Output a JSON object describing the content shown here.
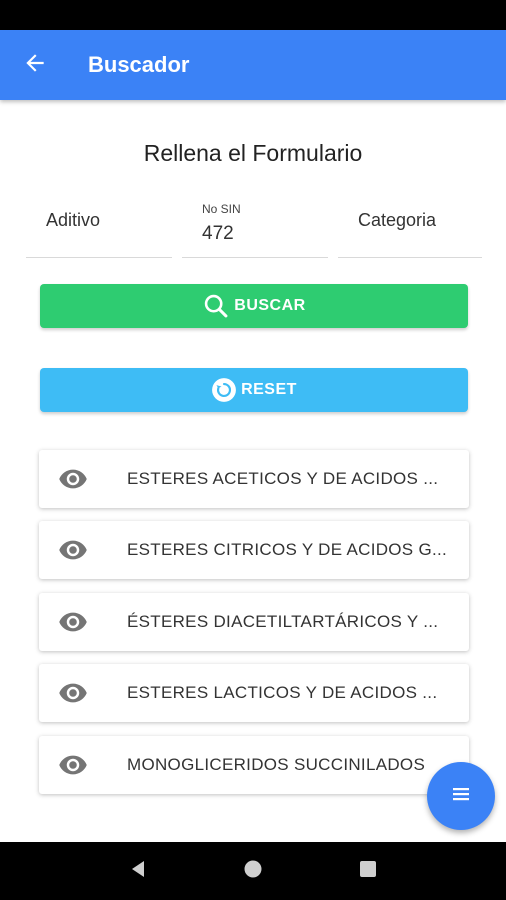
{
  "app_bar": {
    "title": "Buscador",
    "back_icon": "arrow-back-icon"
  },
  "form": {
    "title": "Rellena el Formulario",
    "fields": [
      {
        "placeholder": "Aditivo",
        "label": "",
        "value": ""
      },
      {
        "placeholder": "",
        "label": "No SIN",
        "value": "472"
      },
      {
        "placeholder": "Categoria",
        "label": "",
        "value": ""
      }
    ]
  },
  "buttons": {
    "search_label": "BUSCAR",
    "reset_label": "RESET"
  },
  "results": [
    {
      "label": "ESTERES ACETICOS Y DE ACIDOS ...",
      "icon": "eye-icon"
    },
    {
      "label": "ESTERES CITRICOS Y DE ACIDOS G...",
      "icon": "eye-icon"
    },
    {
      "label": "ÉSTERES DIACETILTARTÁRICOS Y ...",
      "icon": "eye-icon"
    },
    {
      "label": "ESTERES LACTICOS Y DE ACIDOS ...",
      "icon": "eye-icon"
    },
    {
      "label": "MONOGLICERIDOS SUCCINILADOS",
      "icon": "eye-icon"
    }
  ],
  "colors": {
    "primary": "#3b82f6",
    "search_button": "#2ecc71",
    "reset_button": "#3ebcf5"
  }
}
